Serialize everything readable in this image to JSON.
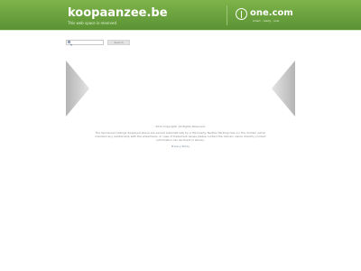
{
  "header": {
    "site_name": "koopaanzee.be",
    "tagline": "This web space is reserved",
    "logo_text": "one.com",
    "logo_subtext": "smart · ready · now"
  },
  "search": {
    "placeholder": "",
    "button_label": "Search"
  },
  "footer": {
    "copyright": "2012 Copyright. All Rights Reserved.",
    "disclaimer": "The Sponsored Listings displayed above are served automatically by a third party. Neither Parkingcrew nor the domain owner maintain any relationship with the advertisers. In case of trademark issues please contact the domain owner directly (contact information can be found in whois).",
    "privacy_label": "Privacy Policy"
  },
  "colors": {
    "header_green": "#6aa23f",
    "arrow_gray": "#c8c8c8"
  },
  "icons": [
    "search-icon",
    "one-com-logo-icon",
    "chevron-left-icon",
    "chevron-right-icon"
  ]
}
